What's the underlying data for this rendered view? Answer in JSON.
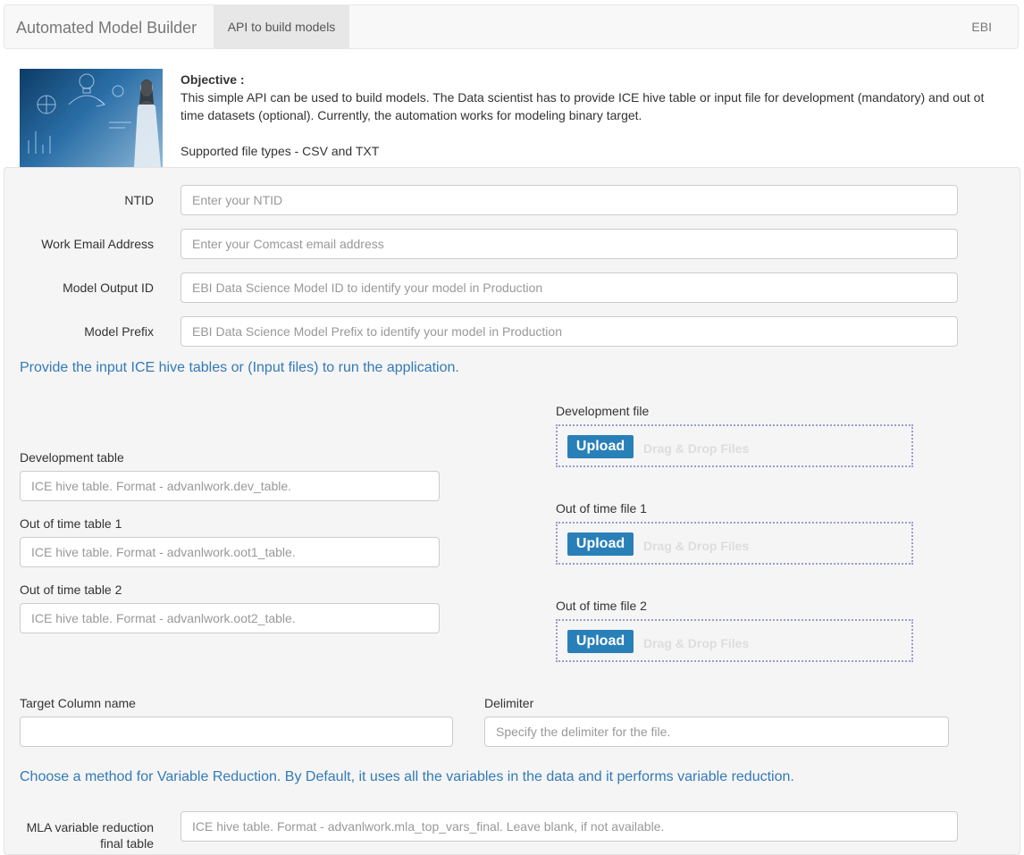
{
  "navbar": {
    "brand": "Automated Model Builder",
    "active_tab": "API to build models",
    "right_link": "EBI"
  },
  "objective": {
    "title": "Objective :",
    "body": "This simple API can be used to build models. The Data scientist has to provide ICE hive table or input file for development (mandatory) and out ot time datasets (optional). Currently, the automation works for modeling binary target.",
    "file_types": "Supported file types - CSV and TXT"
  },
  "form": {
    "ntid": {
      "label": "NTID",
      "placeholder": "Enter your NTID"
    },
    "email": {
      "label": "Work Email Address",
      "placeholder": "Enter your Comcast email address"
    },
    "model_output_id": {
      "label": "Model Output ID",
      "placeholder": "EBI Data Science Model ID to identify your model in Production"
    },
    "model_prefix": {
      "label": "Model Prefix",
      "placeholder": "EBI Data Science Model Prefix to identify your model in Production"
    }
  },
  "input_section": {
    "heading": "Provide the input ICE hive tables or (Input files) to run the application.",
    "dev_table": {
      "label": "Development table",
      "placeholder": "ICE hive table. Format - advanlwork.dev_table."
    },
    "oot1_table": {
      "label": "Out of time table 1",
      "placeholder": "ICE hive table. Format - advanlwork.oot1_table."
    },
    "oot2_table": {
      "label": "Out of time table 2",
      "placeholder": "ICE hive table. Format - advanlwork.oot2_table."
    },
    "dev_file": {
      "label": "Development file"
    },
    "oot1_file": {
      "label": "Out of time file 1"
    },
    "oot2_file": {
      "label": "Out of time file 2"
    },
    "upload_label": "Upload",
    "drop_hint": "Drag & Drop Files"
  },
  "target": {
    "label": "Target Column name",
    "value": ""
  },
  "delimiter": {
    "label": "Delimiter",
    "placeholder": "Specify the delimiter for the file."
  },
  "reduction_section": {
    "heading": "Choose a method for Variable Reduction. By Default, it uses all the variables in the data and it performs variable reduction.",
    "mla_label": "MLA variable reduction final table",
    "mla_placeholder": "ICE hive table. Format - advanlwork.mla_top_vars_final. Leave blank, if not available."
  }
}
